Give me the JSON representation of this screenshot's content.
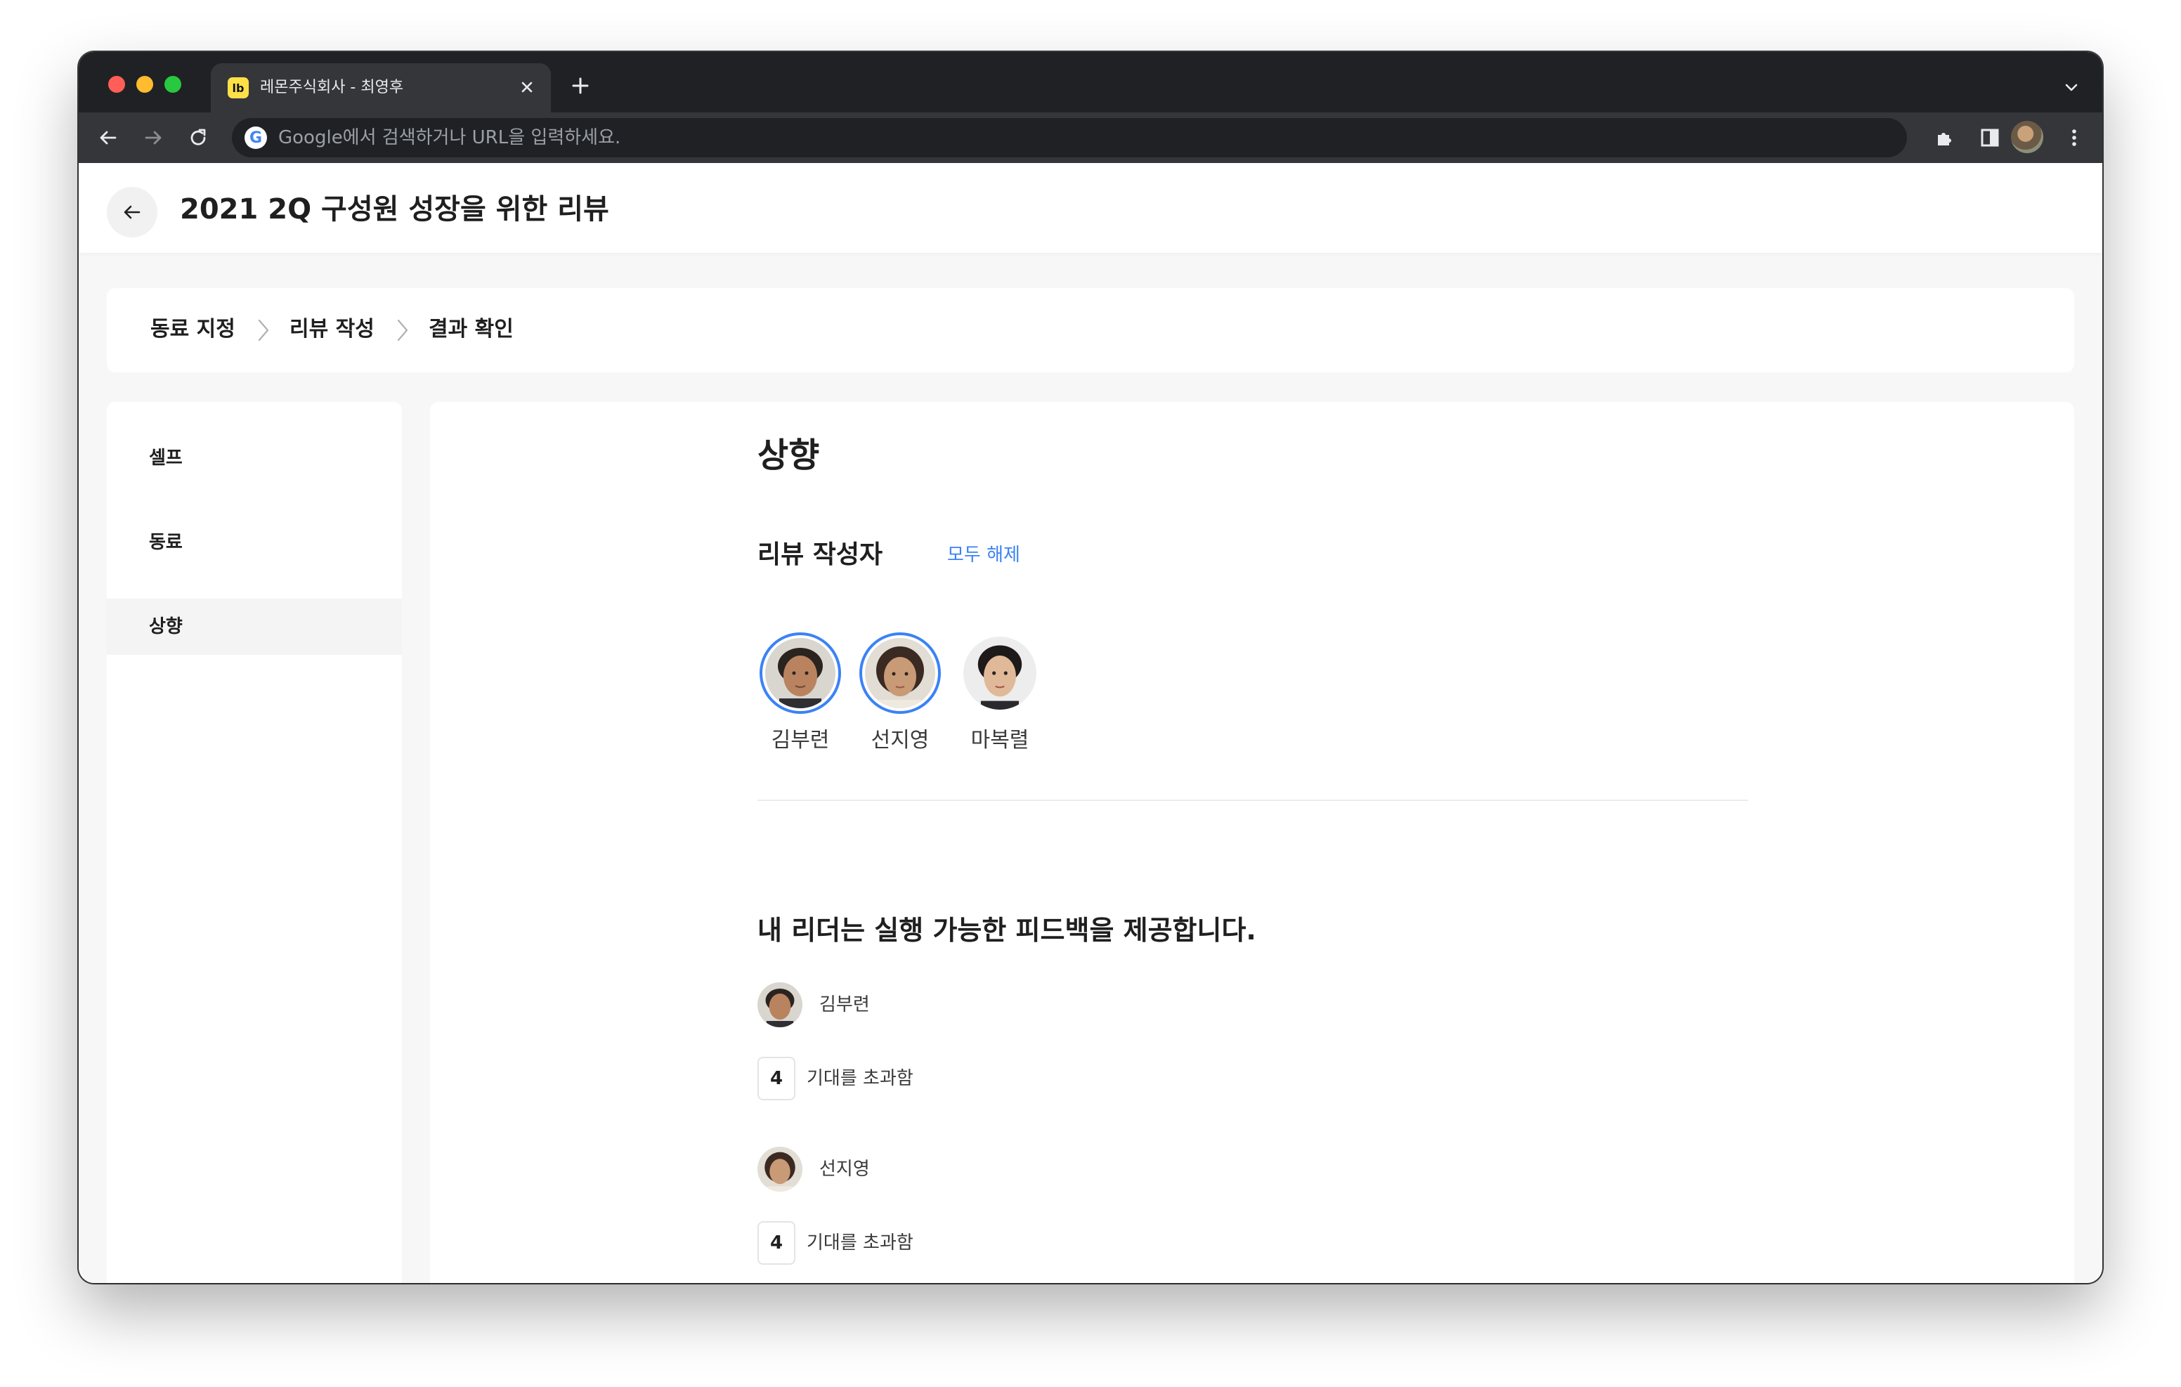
{
  "browser": {
    "tab_favicon": "lb",
    "tab_title": "레몬주식회사 - 최영후",
    "omnibox_placeholder": "Google에서 검색하거나 URL을 입력하세요."
  },
  "header": {
    "title": "2021 2Q 구성원 성장을 위한 리뷰"
  },
  "stepper": {
    "steps": [
      "동료 지정",
      "리뷰 작성",
      "결과 확인"
    ]
  },
  "sidebar": {
    "items": [
      {
        "label": "셀프",
        "active": false
      },
      {
        "label": "동료",
        "active": false
      },
      {
        "label": "상향",
        "active": true
      }
    ]
  },
  "main": {
    "section_title": "상향",
    "reviewers_label": "리뷰 작성자",
    "clear_all": "모두 해제",
    "reviewers": [
      {
        "name": "김부련",
        "selected": true
      },
      {
        "name": "선지영",
        "selected": true
      },
      {
        "name": "마복렬",
        "selected": false
      }
    ],
    "question": "내 리더는 실행 가능한 피드백을 제공합니다.",
    "answers": [
      {
        "name": "김부련",
        "score": "4",
        "score_label": "기대를 초과함"
      },
      {
        "name": "선지영",
        "score": "4",
        "score_label": "기대를 초과함"
      }
    ]
  },
  "colors": {
    "accent": "#3b82f6",
    "favicon": "#fde047",
    "page_bg": "#f7f7f8"
  }
}
